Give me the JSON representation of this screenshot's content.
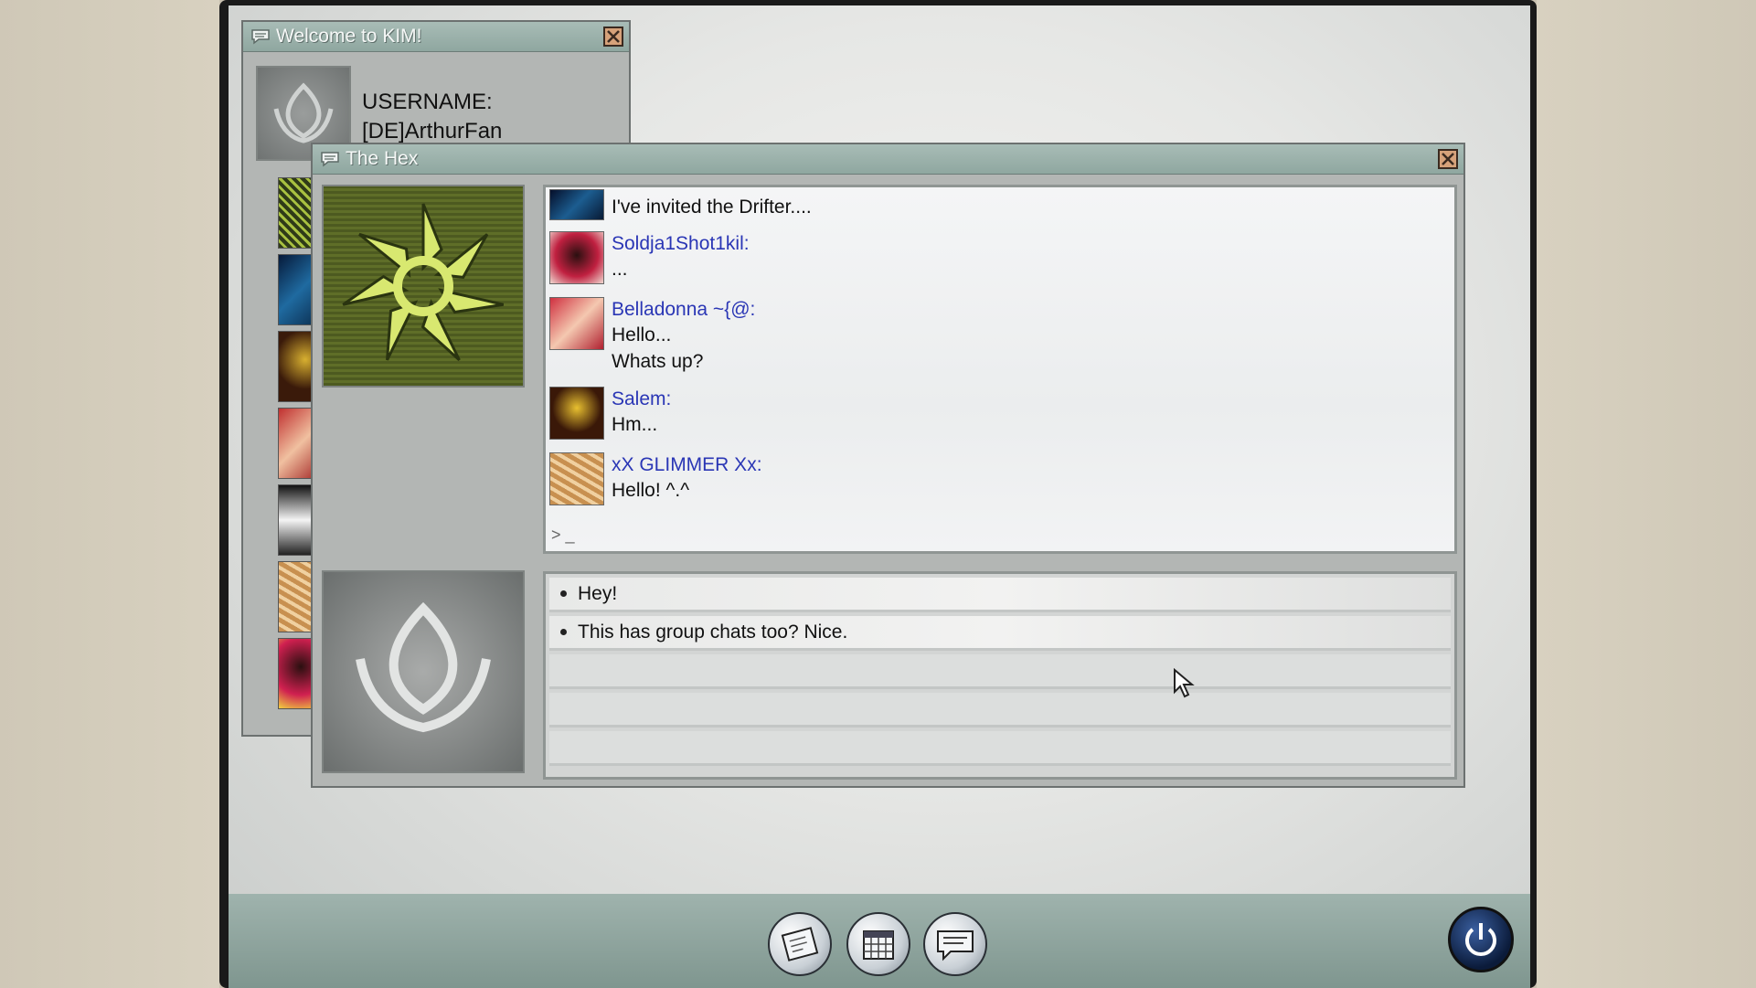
{
  "welcome_window": {
    "title": "Welcome to KIM!",
    "username_label": "USERNAME:",
    "username_value": "[DE]ArthurFan"
  },
  "chat_window": {
    "title": "The Hex",
    "messages": [
      {
        "name": "",
        "lines": [
          "I've invited the Drifter...."
        ],
        "avatar": "drifter-avatar"
      },
      {
        "name": "Soldja1Shot1kil:",
        "lines": [
          "..."
        ],
        "avatar": "soldja-avatar"
      },
      {
        "name": "Belladonna ~{@:",
        "lines": [
          "Hello...",
          "Whats up?"
        ],
        "avatar": "belladonna-avatar"
      },
      {
        "name": "Salem:",
        "lines": [
          "Hm..."
        ],
        "avatar": "salem-avatar"
      },
      {
        "name": "xX GLIMMER Xx:",
        "lines": [
          "Hello! ^.^"
        ],
        "avatar": "glimmer-avatar"
      }
    ],
    "prompt": "> _",
    "replies": [
      "Hey!",
      "This has group chats too? Nice."
    ]
  },
  "taskbar": {
    "icons": [
      "notebook-icon",
      "calendar-icon",
      "chat-bubble-icon"
    ],
    "power": "power-icon"
  },
  "colors": {
    "name_blue": "#2a36b5",
    "titlebar": "#9fb5ae",
    "taskbar": "#8fa69f"
  }
}
